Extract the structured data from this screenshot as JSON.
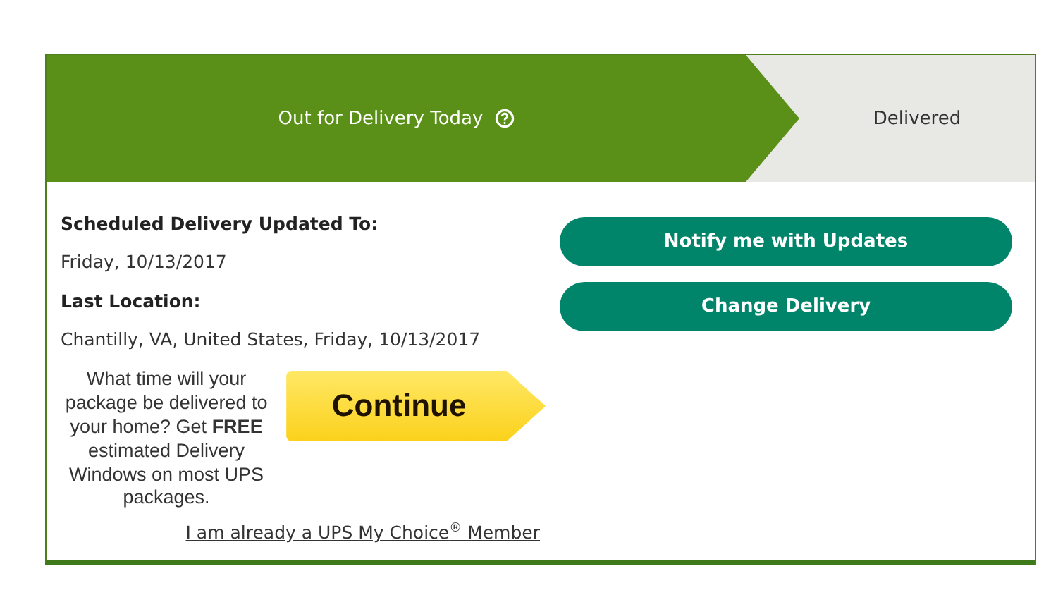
{
  "steps": [
    {
      "label": "Out for Delivery Today",
      "selected": true,
      "help": true
    },
    {
      "label": "Delivered",
      "selected": false,
      "help": false
    }
  ],
  "details": [
    {
      "label": "Scheduled Delivery Updated To:",
      "value": "Friday, 10/13/2017"
    },
    {
      "label": "Last Location:",
      "value": "Chantilly, VA, United States, Friday, 10/13/2017"
    }
  ],
  "promo": {
    "text": "What time will your package be delivered to your home? Get **FREE** estimated Delivery Windows on most UPS packages.",
    "button": "Continue",
    "link": "I am already a UPS My Choice$^{®}$ Member"
  },
  "actions": [
    "Notify me with Updates",
    "Change Delivery"
  ]
}
